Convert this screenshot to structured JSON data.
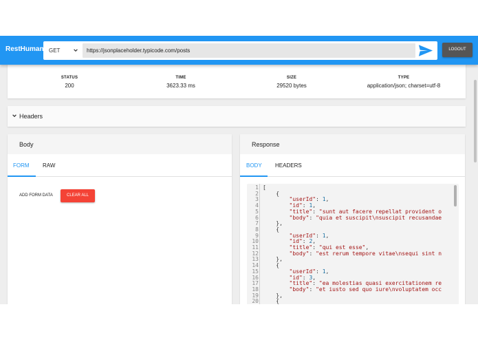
{
  "app": {
    "title": "RestHuman",
    "logout_label": "LOGOUT"
  },
  "request": {
    "method": "GET",
    "url": "https://jsonplaceholder.typicode.com/posts"
  },
  "stats": [
    {
      "label": "STATUS",
      "value": "200"
    },
    {
      "label": "TIME",
      "value": "3623.33 ms"
    },
    {
      "label": "SIZE",
      "value": "29520 bytes"
    },
    {
      "label": "TYPE",
      "value": "application/json; charset=utf-8"
    }
  ],
  "headers_section": {
    "title": "Headers"
  },
  "body_panel": {
    "title": "Body",
    "tabs": [
      "FORM",
      "RAW"
    ],
    "active_tab": "FORM",
    "add_form_data_label": "ADD FORM DATA",
    "clear_all_label": "CLEAR ALL"
  },
  "response_panel": {
    "title": "Response",
    "tabs": [
      "BODY",
      "HEADERS"
    ],
    "active_tab": "BODY",
    "line_numbers": [
      "1",
      "2",
      "3",
      "4",
      "5",
      "6",
      "7",
      "8",
      "9",
      "10",
      "11",
      "12",
      "13",
      "14",
      "15",
      "16",
      "17",
      "18",
      "19",
      "20"
    ],
    "code_lines": [
      "[",
      "    {",
      "        \"userId\": 1,",
      "        \"id\": 1,",
      "        \"title\": \"sunt aut facere repellat provident o",
      "        \"body\": \"quia et suscipit\\nsuscipit recusandae",
      "    },",
      "    {",
      "        \"userId\": 1,",
      "        \"id\": 2,",
      "        \"title\": \"qui est esse\",",
      "        \"body\": \"est rerum tempore vitae\\nsequi sint n",
      "    },",
      "    {",
      "        \"userId\": 1,",
      "        \"id\": 3,",
      "        \"title\": \"ea molestias quasi exercitationem re",
      "        \"body\": \"et iusto sed quo iure\\nvoluptatem occ",
      "    },",
      "    {"
    ]
  },
  "colors": {
    "primary": "#2196f3",
    "danger": "#f44336",
    "logout": "#555555",
    "code_string": "#a31515"
  }
}
